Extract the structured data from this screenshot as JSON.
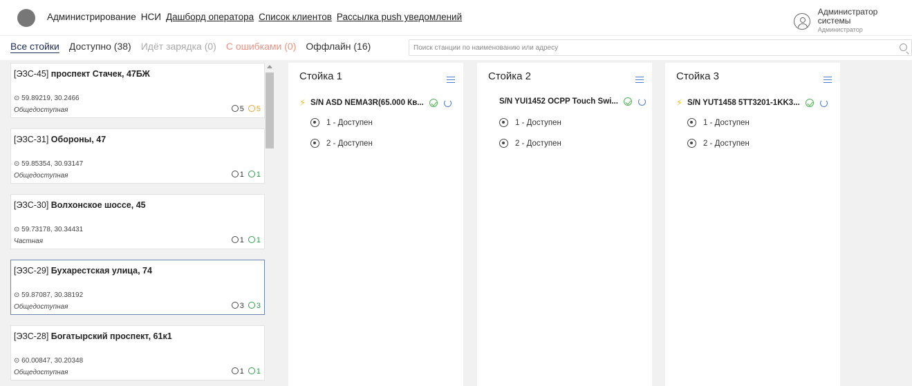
{
  "nav": {
    "links": [
      {
        "label": "Администрирование",
        "underline": false
      },
      {
        "label": "НСИ",
        "underline": false
      },
      {
        "label": "Дашборд оператора",
        "underline": true
      },
      {
        "label": "Список клиентов",
        "underline": true
      },
      {
        "label": "Рассылка push уведомлений",
        "underline": true
      }
    ],
    "user": {
      "name": "Администратор системы",
      "role": "Администратор"
    }
  },
  "tabs": [
    {
      "label": "Все стойки",
      "state": "active"
    },
    {
      "label": "Доступно (38)",
      "state": "normal"
    },
    {
      "label": "Идёт зарядка (0)",
      "state": "muted"
    },
    {
      "label": "С ошибками (0)",
      "state": "error"
    },
    {
      "label": "Оффлайн (16)",
      "state": "normal"
    }
  ],
  "search": {
    "placeholder": "Поиск станции по наименованию или адресу"
  },
  "stations": [
    {
      "code": "[ЭЗС-45]",
      "address": "проспект Стачек, 47БЖ",
      "coords": "59.89219, 30.2466",
      "type": "Общедоступная",
      "total": "5",
      "second": "5",
      "second_kind": "error",
      "selected": false
    },
    {
      "code": "[ЭЗС-31]",
      "address": "Обороны, 47",
      "coords": "59.85354, 30.93147",
      "type": "Общедоступная",
      "total": "1",
      "second": "1",
      "second_kind": "ok",
      "selected": false
    },
    {
      "code": "[ЭЗС-30]",
      "address": "Волхонское шоссе, 45",
      "coords": "59.73178, 30.34431",
      "type": "Частная",
      "total": "1",
      "second": "1",
      "second_kind": "ok",
      "selected": false
    },
    {
      "code": "[ЭЗС-29]",
      "address": "Бухарестская улица, 74",
      "coords": "59.87087, 30.38192",
      "type": "Общедоступная",
      "total": "3",
      "second": "3",
      "second_kind": "ok",
      "selected": true
    },
    {
      "code": "[ЭЗС-28]",
      "address": "Богатырский проспект, 61к1",
      "coords": "60.00847, 30.20348",
      "type": "Общедоступная",
      "total": "1",
      "second": "1",
      "second_kind": "ok",
      "selected": false
    }
  ],
  "columns": [
    {
      "title": "Стойка 1",
      "device": "S/N ASD NEMA3R(65.000 Кв...",
      "bolt": true,
      "connectors": [
        "1 - Доступен",
        "2 - Доступен"
      ]
    },
    {
      "title": "Стойка 2",
      "device": "S/N YUI1452 OCPP Touch Swi...",
      "bolt": false,
      "connectors": [
        "1 - Доступен",
        "2 - Доступен"
      ]
    },
    {
      "title": "Стойка 3",
      "device": "S/N YUT1458 5TT3201-1KK3...",
      "bolt": true,
      "connectors": [
        "1 - Доступен",
        "2 - Доступен"
      ]
    }
  ]
}
